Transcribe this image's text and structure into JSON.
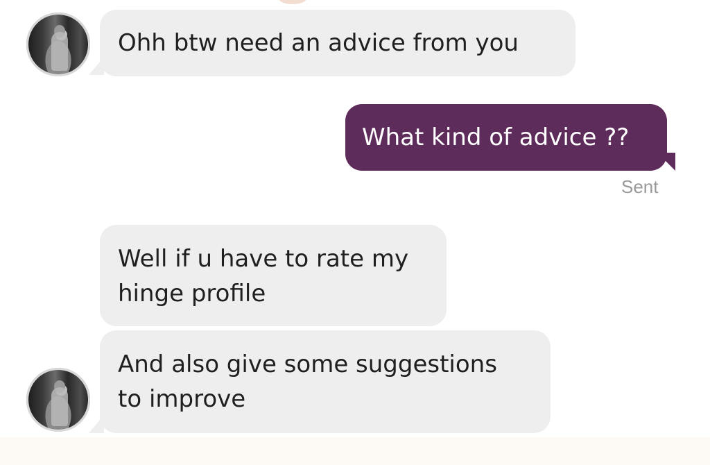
{
  "messages": [
    {
      "direction": "incoming",
      "text": "Ohh btw need an advice from you"
    },
    {
      "direction": "outgoing",
      "text": "What kind of advice ??",
      "status": "Sent"
    },
    {
      "direction": "incoming",
      "text": "Well if u have to rate my\nhinge profile"
    },
    {
      "direction": "incoming",
      "text": "And also give some suggestions\nto improve"
    }
  ],
  "colors": {
    "incoming_bubble": "#efeeef",
    "outgoing_bubble": "#5e2c5b",
    "sent_status": "#9a9a9a"
  },
  "icons": {
    "avatar": "contact-avatar-photo"
  }
}
